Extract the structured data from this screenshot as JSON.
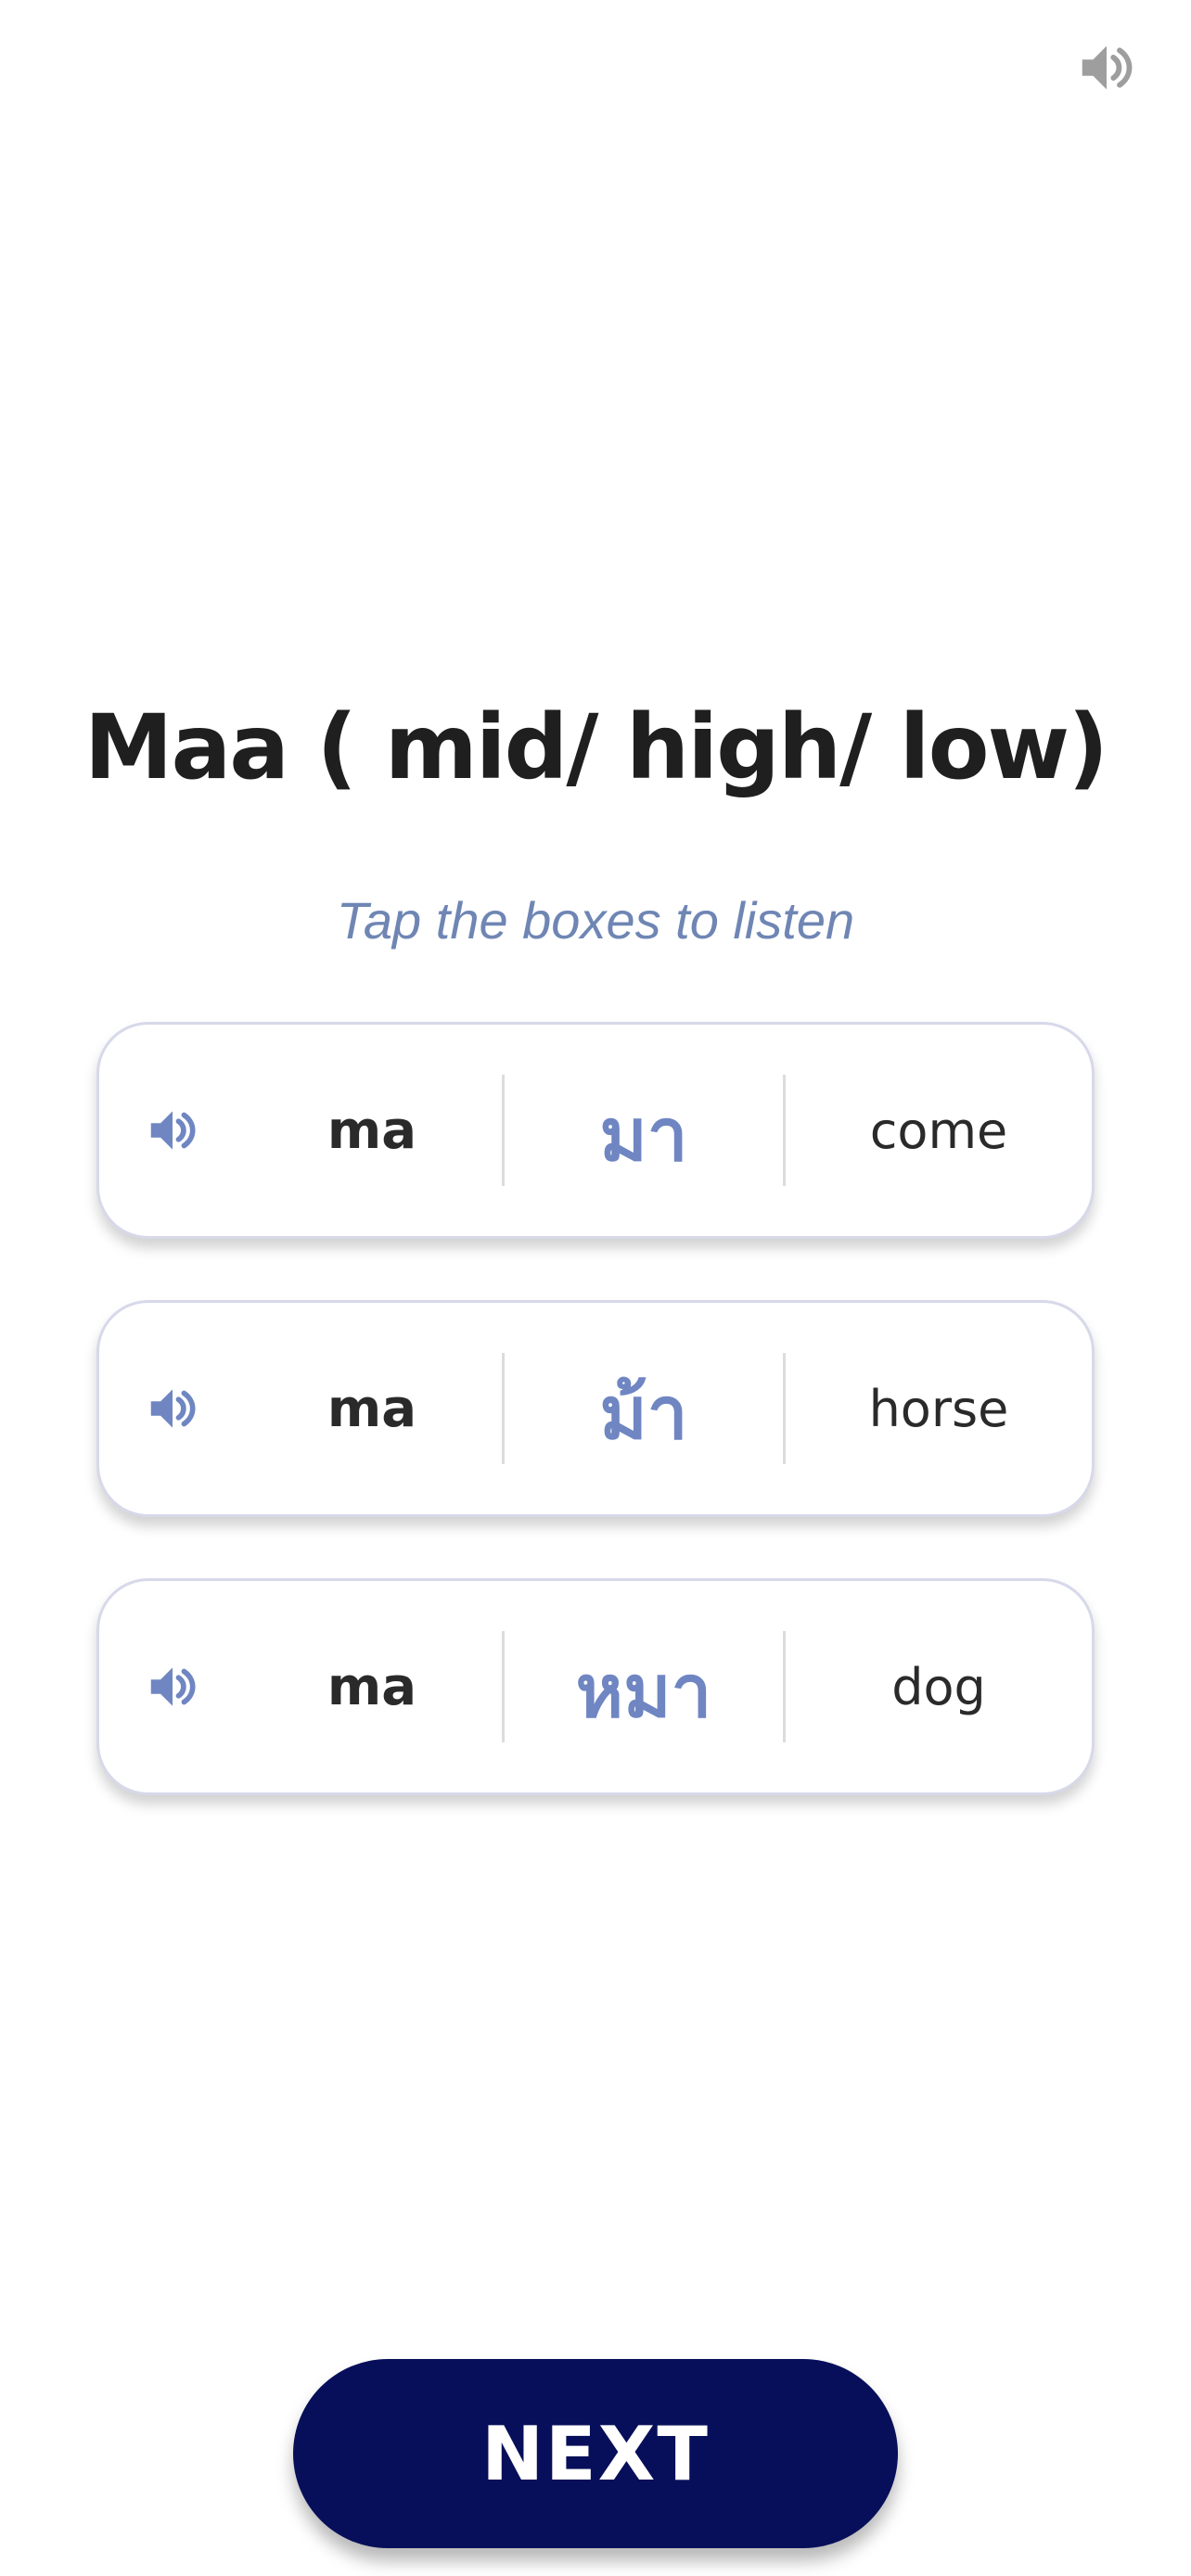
{
  "header": {
    "sound_icon": "speaker-icon"
  },
  "lesson": {
    "title": "Maa ( mid/ high/ low)",
    "instruction": "Tap the boxes to listen"
  },
  "cards": [
    {
      "romanization": "ma",
      "thai": "มา",
      "meaning": "come",
      "icon": "speaker-icon"
    },
    {
      "romanization": "ma",
      "thai": "ม้า",
      "meaning": "horse",
      "icon": "speaker-icon"
    },
    {
      "romanization": "ma",
      "thai": "หมา",
      "meaning": "dog",
      "icon": "speaker-icon"
    }
  ],
  "footer": {
    "next_label": "NEXT"
  },
  "colors": {
    "accent": "#6f86c2",
    "button": "#070f5a",
    "icon_gray": "#9e9e9e"
  }
}
